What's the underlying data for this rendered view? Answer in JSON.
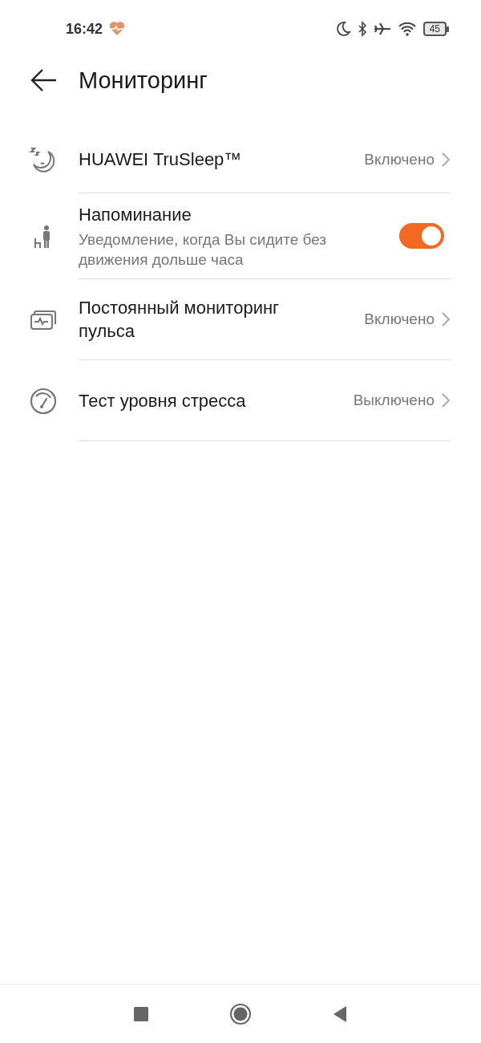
{
  "status_bar": {
    "time": "16:42",
    "battery": "45"
  },
  "header": {
    "title": "Мониторинг"
  },
  "rows": [
    {
      "kind": "link",
      "title": "HUAWEI TruSleep™",
      "value": "Включено"
    },
    {
      "kind": "switch",
      "title": "Напоминание",
      "subtitle": "Уведомление, когда Вы сидите без движения дольше часа",
      "on": true
    },
    {
      "kind": "link",
      "title": "Постоянный мониторинг пульса",
      "value": "Включено"
    },
    {
      "kind": "link",
      "title": "Тест уровня стресса",
      "value": "Выключено"
    }
  ]
}
